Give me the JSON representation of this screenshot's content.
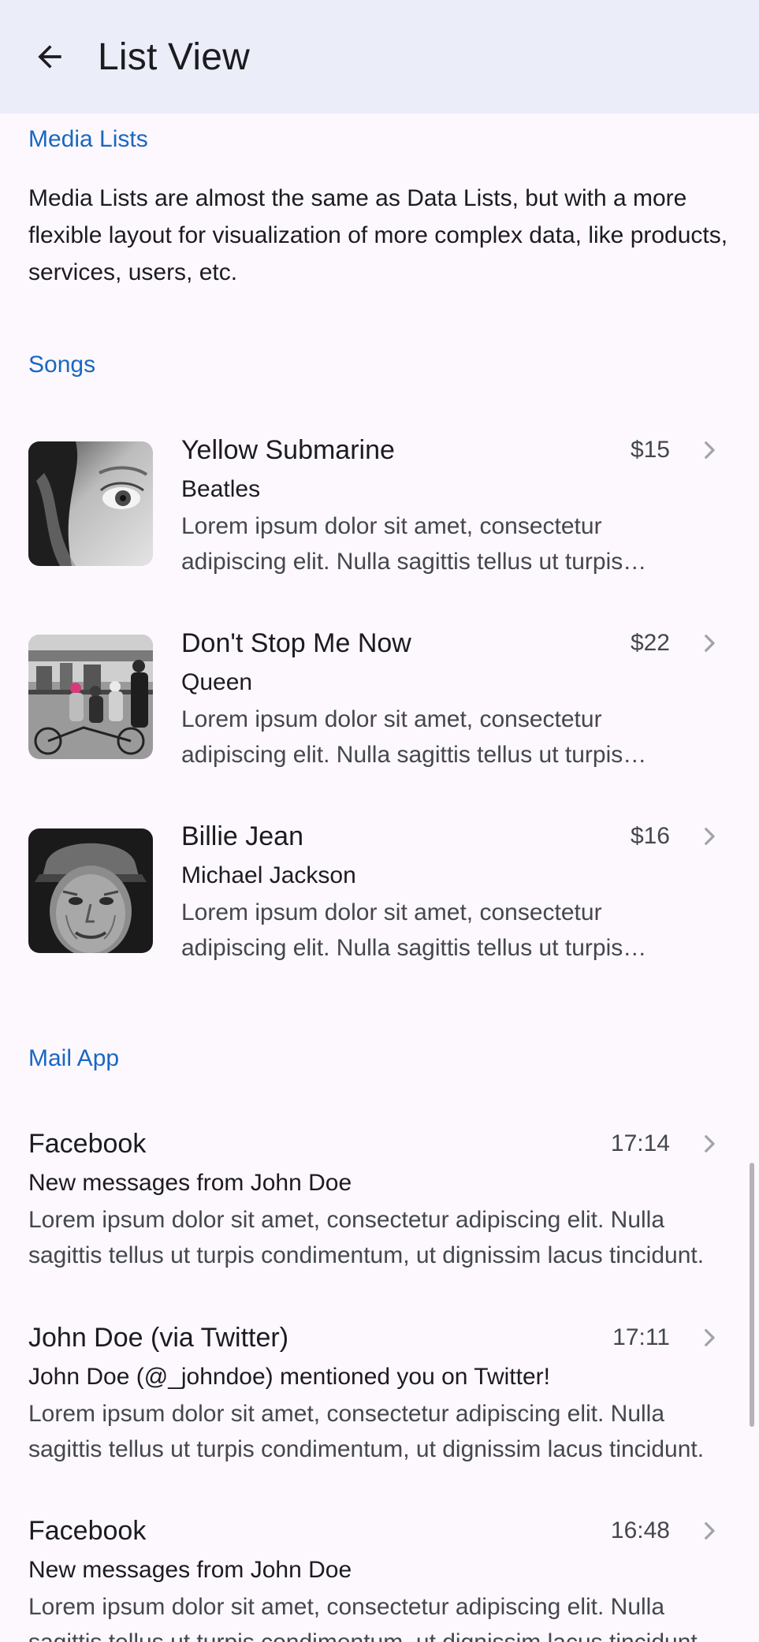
{
  "header": {
    "title": "List View"
  },
  "media_section": {
    "header": "Media Lists",
    "description": "Media Lists are almost the same as Data Lists, but with a more flexible layout for visualization of more complex data, like products, services, users, etc."
  },
  "songs": {
    "header": "Songs",
    "items": [
      {
        "title": "Yellow Submarine",
        "after": "$15",
        "subtitle": "Beatles",
        "text": "Lorem ipsum dolor sit amet, consectetur adipiscing elit. Nulla sagittis tellus ut turpis condimentum, ut dignissim lacus tincidunt."
      },
      {
        "title": "Don't Stop Me Now",
        "after": "$22",
        "subtitle": "Queen",
        "text": "Lorem ipsum dolor sit amet, consectetur adipiscing elit. Nulla sagittis tellus ut turpis condimentum, ut dignissim lacus tincidunt."
      },
      {
        "title": "Billie Jean",
        "after": "$16",
        "subtitle": "Michael Jackson",
        "text": "Lorem ipsum dolor sit amet, consectetur adipiscing elit. Nulla sagittis tellus ut turpis condimentum, ut dignissim lacus tincidunt."
      }
    ]
  },
  "mail": {
    "header": "Mail App",
    "items": [
      {
        "title": "Facebook",
        "after": "17:14",
        "subtitle": "New messages from John Doe",
        "text": "Lorem ipsum dolor sit amet, consectetur adipiscing elit. Nulla sagittis tellus ut turpis condimentum, ut dignissim lacus tincidunt."
      },
      {
        "title": "John Doe (via Twitter)",
        "after": "17:11",
        "subtitle": "John Doe (@_johndoe) mentioned you on Twitter!",
        "text": "Lorem ipsum dolor sit amet, consectetur adipiscing elit. Nulla sagittis tellus ut turpis condimentum, ut dignissim lacus tincidunt."
      },
      {
        "title": "Facebook",
        "after": "16:48",
        "subtitle": "New messages from John Doe",
        "text": "Lorem ipsum dolor sit amet, consectetur adipiscing elit. Nulla sagittis tellus ut turpis condimentum, ut dignissim lacus tincidunt."
      }
    ]
  },
  "icons": {
    "back": "arrow-left-icon",
    "chevron": "chevron-right-icon"
  },
  "colors": {
    "accent": "#1967c2",
    "topbar_bg": "#ebedf9",
    "page_bg": "#fcf8fd",
    "chevron": "#a0a3aa"
  }
}
